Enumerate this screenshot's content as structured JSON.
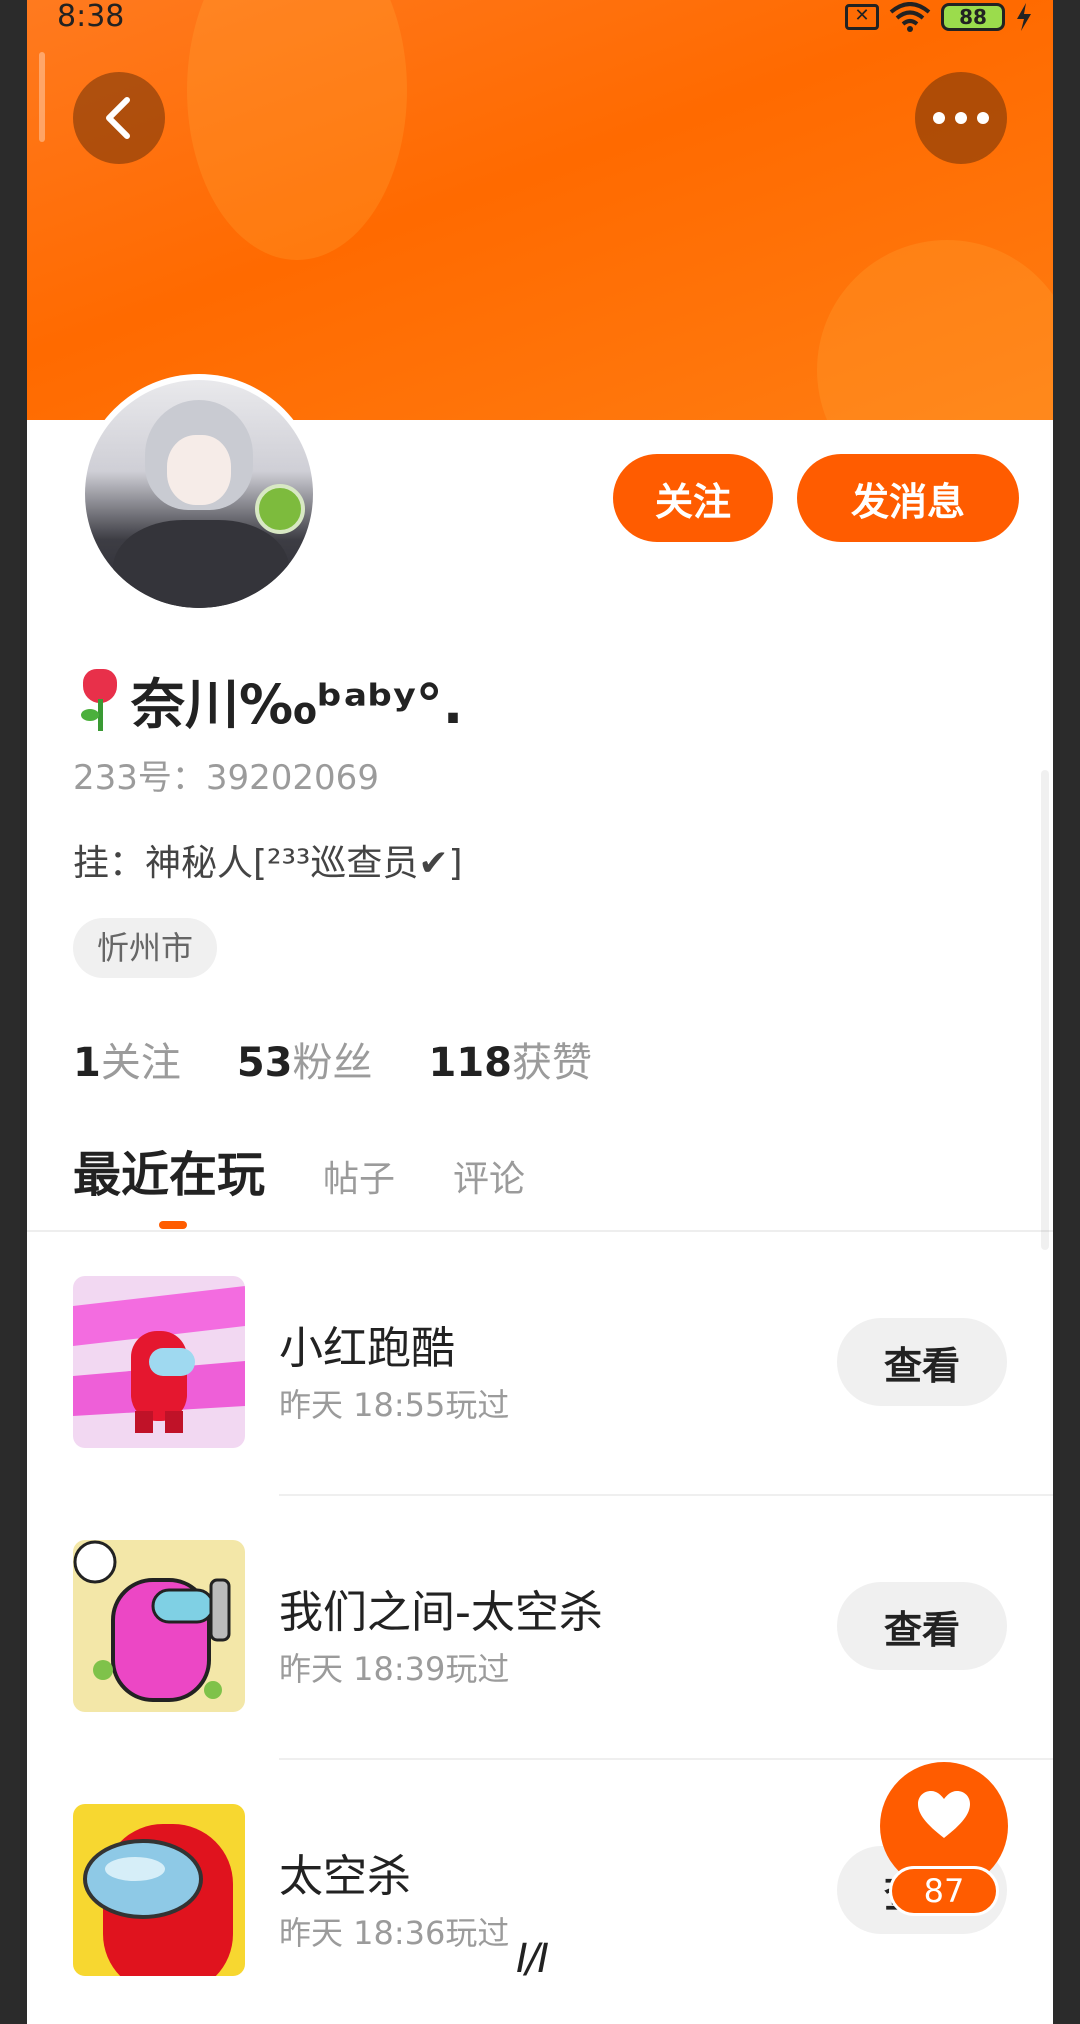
{
  "status_bar": {
    "time": "8:38",
    "battery": "88"
  },
  "header": {
    "back_label": "back",
    "more_label": "more"
  },
  "profile": {
    "follow_label": "关注",
    "message_label": "发消息",
    "name": "奈川‰ᵇᵃᵇʸ°.",
    "uid": "233号：39202069",
    "pendant": "挂：神秘人[²³³巡查员✔]",
    "location": "忻州市",
    "stats": {
      "following_count": "1",
      "following_label": "关注",
      "fans_count": "53",
      "fans_label": "粉丝",
      "likes_count": "118",
      "likes_label": "获赞"
    }
  },
  "tabs": {
    "recent": "最近在玩",
    "posts": "帖子",
    "comments": "评论"
  },
  "games": [
    {
      "title": "小红跑酷",
      "time": "昨天 18:55玩过",
      "button": "查看"
    },
    {
      "title": "我们之间-太空杀",
      "time": "昨天 18:39玩过",
      "button": "查看"
    },
    {
      "title": "太空杀",
      "time": "昨天 18:36玩过",
      "button": "查看"
    }
  ],
  "fab": {
    "count": "87"
  },
  "page_indicator": "I/I",
  "colors": {
    "accent": "#ff5c00",
    "header": "#ff6a00"
  }
}
